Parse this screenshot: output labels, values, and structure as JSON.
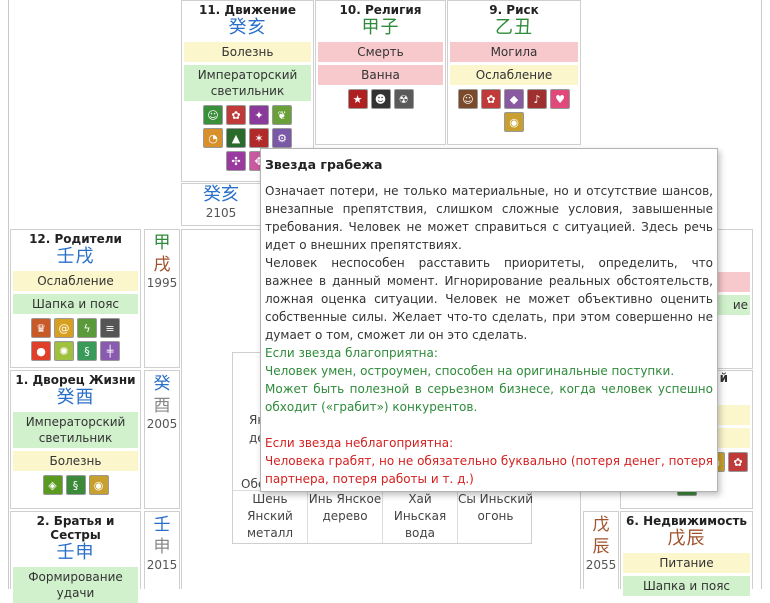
{
  "palaces": {
    "movement": {
      "title": "11. Движение",
      "stems": "癸亥",
      "labels": [
        "Болезнь",
        "Императорский светильник"
      ],
      "icons": [
        "chef-icon",
        "flowers-icon",
        "magic-icon",
        "leaves-icon",
        "pizza-icon",
        "graduate-icon",
        "runner-icon",
        "gears-icon",
        "pinwheel-icon",
        "mosaic-icon"
      ]
    },
    "religion": {
      "title": "10. Религия",
      "stems": "甲子",
      "labels": [
        "Смерть",
        "Ванна"
      ],
      "icons": [
        "star-icon",
        "ninja-icon",
        "radiation-icon"
      ]
    },
    "risk": {
      "title": "9. Риск",
      "stems": "乙丑",
      "labels": [
        "Могила",
        "Ослабление"
      ],
      "icons": [
        "shopper-icon",
        "flowers-icon",
        "coffin-icon",
        "guitar-icon",
        "hearts-icon",
        "coins-icon"
      ]
    },
    "parents": {
      "title": "12. Родители",
      "stems": "壬戌",
      "labels": [
        "Ослабление",
        "Шапка и пояс"
      ],
      "icons": [
        "crown-icon",
        "spiral-icon",
        "lightning-icon",
        "zebra-icon",
        "balloon-icon",
        "confetti-icon",
        "snake-icon",
        "syringe-icon"
      ]
    },
    "palace_of_life": {
      "title": "1. Дворец Жизни",
      "stems": "癸酉",
      "labels": [
        "Императорский светильник",
        "Болезнь"
      ],
      "icons": [
        "shield-icon",
        "dragon-icon",
        "coins-icon"
      ]
    },
    "siblings": {
      "title": "2. Братья и Сестры",
      "stems": "壬申",
      "labels": [
        "Формирование удачи"
      ]
    },
    "property": {
      "title": "6. Недвижимость",
      "stems": "戊辰",
      "labels": [
        "Питание",
        "Шапка и пояс"
      ]
    }
  },
  "columns": {
    "top": {
      "stems": "癸亥",
      "year": "2105"
    },
    "parents": {
      "top": "甲",
      "bottom": "戌",
      "year": "1995"
    },
    "life": {
      "top": "癸",
      "bottom": "酉",
      "year": "2005"
    },
    "siblings": {
      "top": "壬",
      "bottom": "申",
      "year": "2015"
    },
    "property": {
      "top": "戊",
      "bottom": "辰",
      "year": "2055"
    }
  },
  "partial": {
    "right_frag_1": "ие",
    "right_frag_top": "й",
    "tbl_frag1": "Ян",
    "tbl_frag2": "де",
    "tbl_frag3": "Обе"
  },
  "table": {
    "cells": [
      "Шень Янский металл",
      "Инь Янское дерево",
      "Хай Иньская вода",
      "Сы Иньский огонь"
    ]
  },
  "tooltip": {
    "title": "Звезда грабежа",
    "p1": "Означает потери, не только материальные, но и отсутствие шансов, внезапные препятствия, слишком сложные условия, завышенные требования. Человек не может справиться с ситуацией. Здесь речь идет о внешних препятствиях.",
    "p2": "Человек неспособен расставить приоритеты, определить, что важнее в данный момент. Игнорирование реальных обстоятельств, ложная оценка ситуации. Человек не может объективно оценить собственные силы. Желает что-то сделать, при этом совершенно не думает о том, сможет ли он это сделать.",
    "fav_head": "Если звезда благоприятна:",
    "fav_1": "Человек умен, остроумен, способен на оригинальные поступки.",
    "fav_2": "Может быть полезной в серьезном бизнесе, когда человек успешно обходит («грабит») конкурентов.",
    "unfav_head": "Если звезда неблагоприятна:",
    "unfav_1": "Человека грабят, но не обязательно буквально (потеря денег, потеря партнера, потеря работы и т. д.)"
  }
}
